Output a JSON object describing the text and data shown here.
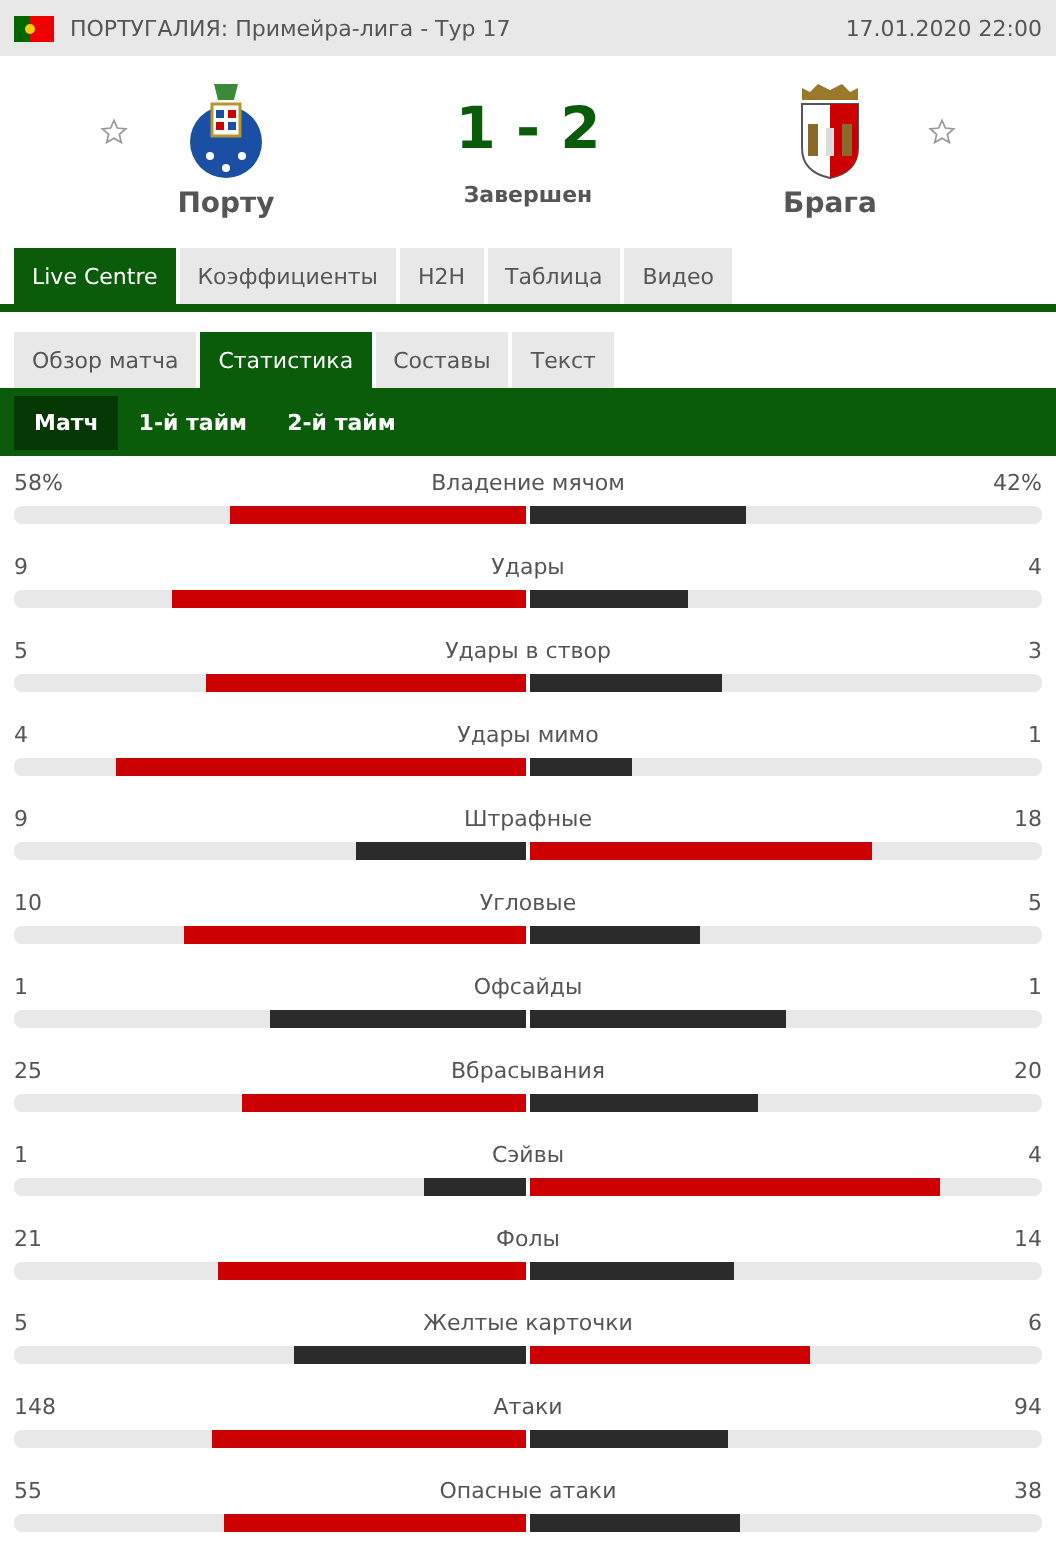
{
  "header": {
    "league": "ПОРТУГАЛИЯ: Примейра-лига - Тур 17",
    "datetime": "17.01.2020 22:00"
  },
  "match": {
    "home": {
      "name": "Порту",
      "favorite": false
    },
    "away": {
      "name": "Брага",
      "favorite": false
    },
    "score": "1 - 2",
    "status": "Завершен"
  },
  "tabs": [
    {
      "label": "Live Centre",
      "selected": true
    },
    {
      "label": "Коэффициенты",
      "selected": false
    },
    {
      "label": "H2H",
      "selected": false
    },
    {
      "label": "Таблица",
      "selected": false
    },
    {
      "label": "Видео",
      "selected": false
    }
  ],
  "subtabs": [
    {
      "label": "Обзор матча",
      "selected": false
    },
    {
      "label": "Статистика",
      "selected": true
    },
    {
      "label": "Составы",
      "selected": false
    },
    {
      "label": "Текст",
      "selected": false
    }
  ],
  "periods": [
    {
      "label": "Матч",
      "selected": true
    },
    {
      "label": "1-й тайм",
      "selected": false
    },
    {
      "label": "2-й тайм",
      "selected": false
    }
  ],
  "stats": [
    {
      "label": "Владение мячом",
      "home": {
        "value": "58%",
        "level": 0.58,
        "leading": true
      },
      "away": {
        "value": "42%",
        "level": 0.42,
        "leading": false
      }
    },
    {
      "label": "Удары",
      "home": {
        "value": "9",
        "level": 0.69,
        "leading": true
      },
      "away": {
        "value": "4",
        "level": 0.31,
        "leading": false
      }
    },
    {
      "label": "Удары в створ",
      "home": {
        "value": "5",
        "level": 0.625,
        "leading": true
      },
      "away": {
        "value": "3",
        "level": 0.375,
        "leading": false
      }
    },
    {
      "label": "Удары мимо",
      "home": {
        "value": "4",
        "level": 0.8,
        "leading": true
      },
      "away": {
        "value": "1",
        "level": 0.2,
        "leading": false
      }
    },
    {
      "label": "Штрафные",
      "home": {
        "value": "9",
        "level": 0.333,
        "leading": false
      },
      "away": {
        "value": "18",
        "level": 0.667,
        "leading": true
      }
    },
    {
      "label": "Угловые",
      "home": {
        "value": "10",
        "level": 0.667,
        "leading": true
      },
      "away": {
        "value": "5",
        "level": 0.333,
        "leading": false
      }
    },
    {
      "label": "Офсайды",
      "home": {
        "value": "1",
        "level": 0.5,
        "leading": false
      },
      "away": {
        "value": "1",
        "level": 0.5,
        "leading": false
      }
    },
    {
      "label": "Вбрасывания",
      "home": {
        "value": "25",
        "level": 0.556,
        "leading": true
      },
      "away": {
        "value": "20",
        "level": 0.444,
        "leading": false
      }
    },
    {
      "label": "Сэйвы",
      "home": {
        "value": "1",
        "level": 0.2,
        "leading": false
      },
      "away": {
        "value": "4",
        "level": 0.8,
        "leading": true
      }
    },
    {
      "label": "Фолы",
      "home": {
        "value": "21",
        "level": 0.6,
        "leading": true
      },
      "away": {
        "value": "14",
        "level": 0.4,
        "leading": false
      }
    },
    {
      "label": "Желтые карточки",
      "home": {
        "value": "5",
        "level": 0.455,
        "leading": false
      },
      "away": {
        "value": "6",
        "level": 0.545,
        "leading": true
      }
    },
    {
      "label": "Атаки",
      "home": {
        "value": "148",
        "level": 0.612,
        "leading": true
      },
      "away": {
        "value": "94",
        "level": 0.388,
        "leading": false
      }
    },
    {
      "label": "Опасные атаки",
      "home": {
        "value": "55",
        "level": 0.591,
        "leading": true
      },
      "away": {
        "value": "38",
        "level": 0.409,
        "leading": false
      }
    }
  ]
}
